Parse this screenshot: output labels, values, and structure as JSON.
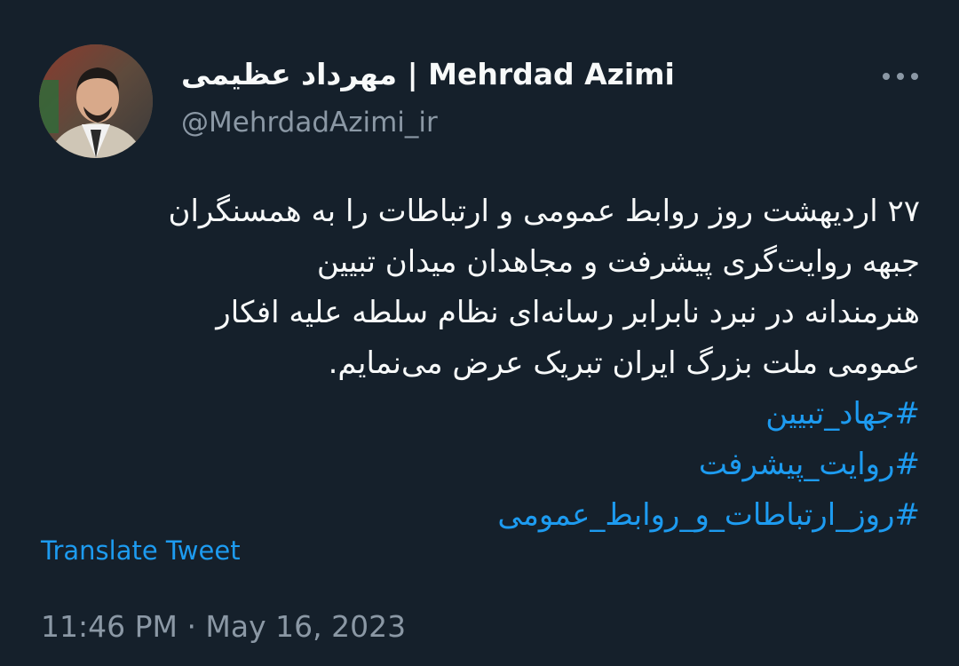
{
  "author": {
    "display_name": "مهرداد عظیمی | Mehrdad Azimi",
    "handle": "@MehrdadAzimi_ir",
    "avatar_icon": "profile-photo"
  },
  "menu": {
    "more_icon": "more-horizontal-icon"
  },
  "tweet": {
    "lines": [
      "۲۷ اردیهشت روز روابط عمومی و ارتباطات را به همسنگران",
      "جبهه روایت‌گری پیشرفت و مجاهدان میدان تبیین",
      "هنرمندانه در نبرد نابرابر رسانه‌ای نظام سلطه علیه افکار",
      "عمومی ملت بزرگ ایران تبریک عرض می‌نمایم."
    ],
    "hashtags": [
      "#جهاد_تبیین",
      "#روایت_پیشرفت",
      "#روز_ارتباطات_و_روابط_عمومی"
    ]
  },
  "translate_label": "Translate Tweet",
  "timestamp": "11:46 PM · May 16, 2023",
  "colors": {
    "background": "#15202b",
    "text": "#f7f9f9",
    "secondary": "#8b98a5",
    "link": "#1d9bf0"
  }
}
